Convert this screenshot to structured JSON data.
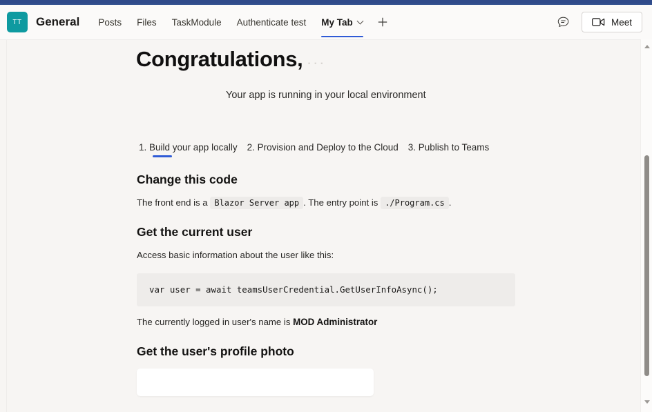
{
  "header": {
    "team_avatar_initials": "TT",
    "channel_title": "General",
    "tabs": [
      {
        "label": "Posts",
        "active": false
      },
      {
        "label": "Files",
        "active": false
      },
      {
        "label": "TaskModule",
        "active": false
      },
      {
        "label": "Authenticate test",
        "active": false
      },
      {
        "label": "My Tab",
        "active": true
      }
    ],
    "add_tab_label": "+",
    "feedback_icon": "chat-bubble-icon",
    "meet_button_label": "Meet",
    "meet_icon": "video-camera-icon"
  },
  "page": {
    "hero_title": "Congratulations,",
    "hero_title_redacted": "...",
    "hero_subtitle": "Your app is running in your local environment",
    "steps": [
      {
        "label": "1. Build your app locally",
        "active": true
      },
      {
        "label": "2. Provision and Deploy to the Cloud",
        "active": false
      },
      {
        "label": "3. Publish to Teams",
        "active": false
      }
    ],
    "section_change_code": {
      "heading": "Change this code",
      "text_before": "The front end is a",
      "code_1": "Blazor Server app",
      "text_middle": ". The entry point is",
      "code_2": "./Program.cs",
      "text_after": "."
    },
    "section_current_user": {
      "heading": "Get the current user",
      "intro": "Access basic information about the user like this:",
      "code_block": "var user = await teamsUserCredential.GetUserInfoAsync();",
      "result_prefix": "The currently logged in user's name is",
      "result_name": "MOD Administrator"
    },
    "section_profile_photo": {
      "heading": "Get the user's profile photo"
    }
  },
  "colors": {
    "top_accent": "#2f4a8a",
    "avatar_teal": "#0e9aa0",
    "active_underline": "#2f5bd6",
    "content_bg": "#f7f5f3",
    "code_bg": "#edebe9"
  },
  "scrollbar": {
    "up_arrow_icon": "caret-up-icon",
    "down_arrow_icon": "caret-down-icon"
  }
}
